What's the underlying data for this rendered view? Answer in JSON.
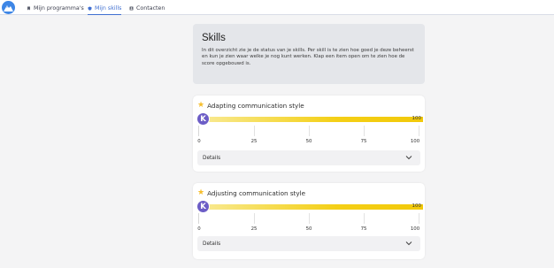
{
  "nav": {
    "items": [
      {
        "label": "Mijn programma's",
        "icon": "bookmark-icon"
      },
      {
        "label": "Mijn skills",
        "icon": "shield-icon",
        "active": true
      },
      {
        "label": "Contacten",
        "icon": "contacts-icon"
      }
    ]
  },
  "intro": {
    "title": "Skills",
    "text": "In dit overzicht zie je de status van je skills. Per skill is te zien hoe goed je deze beheerst en kun je zien waar welke je nog kunt werken. Klap een item open om te zien hoe de score opgebouwd is."
  },
  "skills": [
    {
      "title": "Adapting communication style",
      "badge": "K",
      "score": "100",
      "ticks": [
        "0",
        "25",
        "50",
        "75",
        "100"
      ],
      "details_label": "Details"
    },
    {
      "title": "Adjusting communication style",
      "badge": "K",
      "score": "100",
      "ticks": [
        "0",
        "25",
        "50",
        "75",
        "100"
      ],
      "details_label": "Details"
    }
  ],
  "colors": {
    "accent": "#3f6fd1",
    "bar": "#f4cd14",
    "badge": "#6c5dc6",
    "star": "#f6be2c"
  }
}
